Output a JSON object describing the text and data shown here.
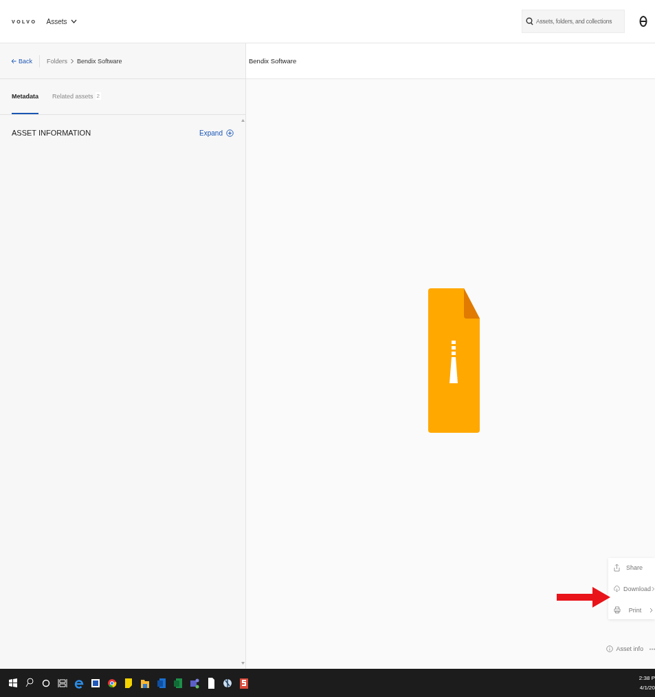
{
  "header": {
    "logo": "VOLVO",
    "menu": "Assets",
    "search": {
      "placeholder": "Assets, folders, and collections"
    }
  },
  "breadcrumb": {
    "back": "Back",
    "items": [
      "Folders",
      "Bendix Software"
    ]
  },
  "tabs": [
    {
      "label": "Metadata",
      "selected": true
    },
    {
      "label": "Related assets",
      "count": "2",
      "selected": false
    }
  ],
  "section": {
    "title": "ASSET INFORMATION",
    "action": "Expand"
  },
  "preview": {
    "title": "Bendix Software"
  },
  "menu": [
    {
      "kind": "share",
      "label": "Share",
      "submenu": false
    },
    {
      "kind": "download",
      "label": "Download",
      "submenu": true
    },
    {
      "kind": "print",
      "label": "Print",
      "submenu": true
    }
  ],
  "footer": {
    "info": "Asset info"
  },
  "taskbar": {
    "time": "2:38 P",
    "date": "4/1/20"
  }
}
